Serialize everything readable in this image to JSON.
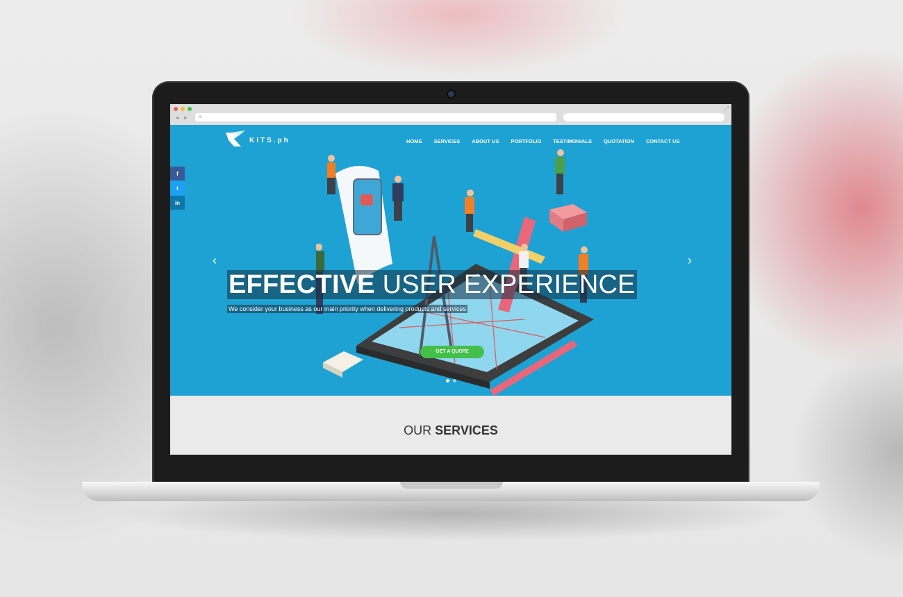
{
  "browser": {
    "url_placeholder": "≡",
    "nav_arrows": "◂ ▸",
    "expand_glyph": "⤢"
  },
  "site": {
    "logo_text": "KITS.ph",
    "nav": [
      "HOME",
      "SERVICES",
      "ABOUT US",
      "PORTFOLIO",
      "TESTIMONIALS",
      "QUOTATION",
      "CONTACT US"
    ],
    "social": [
      {
        "icon": "facebook-icon",
        "label": "f",
        "color": "#3b5998"
      },
      {
        "icon": "twitter-icon",
        "label": "t",
        "color": "#1da1f2"
      },
      {
        "icon": "linkedin-icon",
        "label": "in",
        "color": "#0e76a8"
      }
    ]
  },
  "hero": {
    "headline_bold": "EFFECTIVE",
    "headline_light": "USER EXPERIENCE",
    "subline": "We consider your business as our main priority when delivering products and services",
    "cta_label": "GET A QUOTE",
    "prev_arrow": "‹",
    "next_arrow": "›",
    "slide_count": 2,
    "active_slide": 1
  },
  "services": {
    "title_light": "OUR",
    "title_bold": "SERVICES"
  },
  "colors": {
    "hero_bg": "#1ea2d3",
    "cta": "#43c04a",
    "light_bg": "#eaeaea"
  }
}
